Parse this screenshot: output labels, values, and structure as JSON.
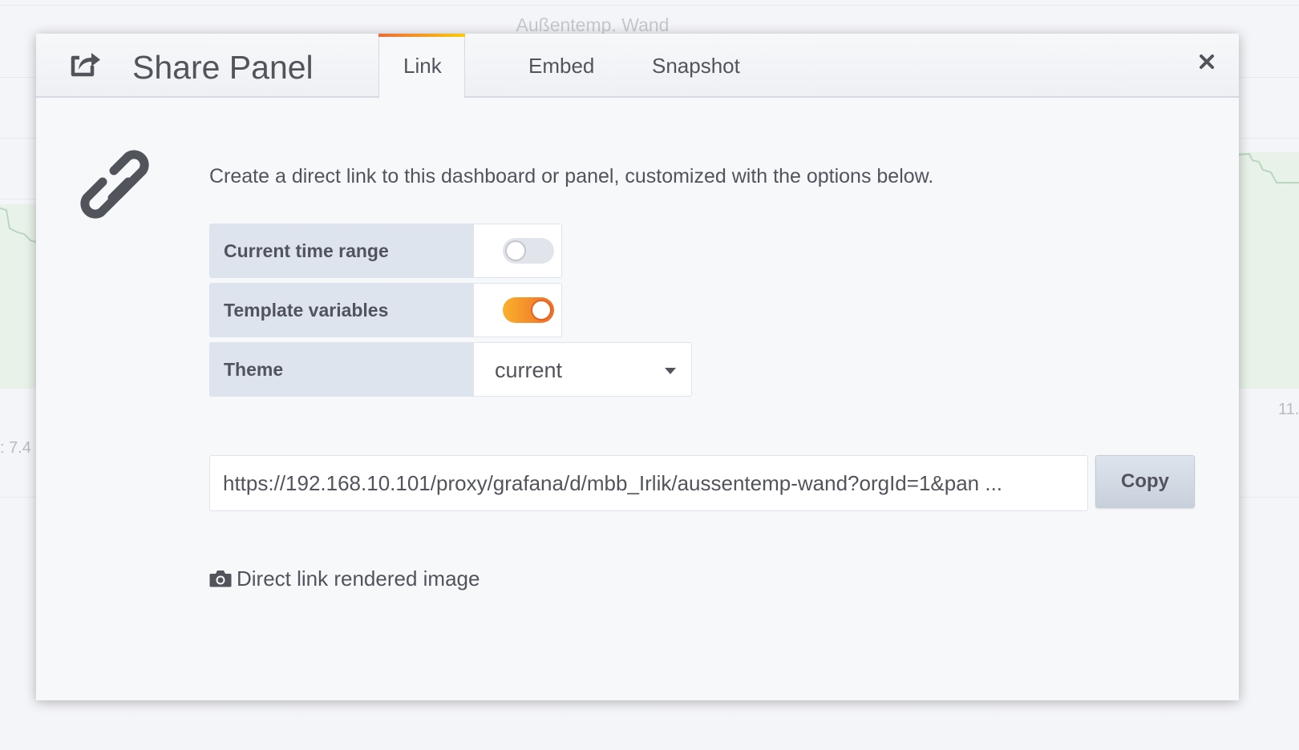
{
  "background": {
    "panel_title": "Außentemp. Wand",
    "left_value": ": 7.4",
    "right_value": "11."
  },
  "modal": {
    "title": "Share Panel",
    "header_icon": "share-square-icon",
    "close_icon": "close-icon",
    "tabs": [
      {
        "label": "Link",
        "active": true
      },
      {
        "label": "Embed",
        "active": false
      },
      {
        "label": "Snapshot",
        "active": false
      }
    ]
  },
  "link_tab": {
    "icon": "chain-link-icon",
    "description": "Create a direct link to this dashboard or panel, customized with the options below.",
    "options": [
      {
        "label": "Current time range",
        "type": "toggle",
        "checked": false
      },
      {
        "label": "Template variables",
        "type": "toggle",
        "checked": true
      },
      {
        "label": "Theme",
        "type": "select",
        "value": "current"
      }
    ],
    "url": "https://192.168.10.101/proxy/grafana/d/mbb_Irlik/aussentemp-wand?orgId=1&pan ...",
    "copy_label": "Copy",
    "render_icon": "camera-icon",
    "render_link_label": "Direct link rendered image"
  },
  "colors": {
    "accent_start": "#fbb02d",
    "accent_end": "#ee6d2b",
    "label_bg": "#dde4ed",
    "text": "#52545c"
  }
}
